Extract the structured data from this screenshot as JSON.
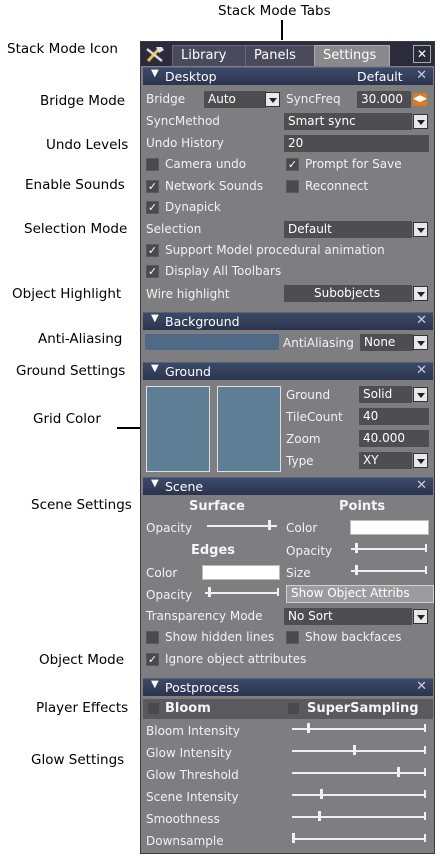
{
  "annotations": {
    "stack_mode_tabs": "Stack Mode Tabs",
    "stack_mode_icon": "Stack Mode Icon",
    "bridge_mode": "Bridge Mode",
    "undo_levels": "Undo Levels",
    "enable_sounds": "Enable Sounds",
    "selection_mode": "Selection Mode",
    "object_highlight": "Object Highlight",
    "anti_aliasing": "Anti-Aliasing",
    "ground_settings": "Ground Settings",
    "grid_color": "Grid Color",
    "scene_settings": "Scene Settings",
    "object_mode": "Object Mode",
    "player_effects": "Player Effects",
    "glow_settings": "Glow Settings"
  },
  "tabs": {
    "library": "Library",
    "panels": "Panels",
    "settings": "Settings",
    "active": "Settings",
    "close": "✕"
  },
  "desktop": {
    "title": "Desktop",
    "preset": "Default",
    "bridge_label": "Bridge",
    "bridge_value": "Auto",
    "syncfreq_label": "SyncFreq",
    "syncfreq_value": "30.000",
    "syncmethod_label": "SyncMethod",
    "syncmethod_value": "Smart sync",
    "undo_label": "Undo History",
    "undo_value": "20",
    "camera_undo": "Camera undo",
    "camera_undo_checked": false,
    "prompt_save": "Prompt for Save",
    "prompt_save_checked": true,
    "network_sounds": "Network Sounds",
    "network_sounds_checked": true,
    "reconnect": "Reconnect",
    "reconnect_checked": false,
    "dynapick": "Dynapick",
    "dynapick_checked": true,
    "selection_label": "Selection",
    "selection_value": "Default",
    "support_model": "Support Model procedural animation",
    "support_model_checked": true,
    "display_toolbars": "Display All Toolbars",
    "display_toolbars_checked": true,
    "wire_label": "Wire highlight",
    "wire_value": "Subobjects"
  },
  "background": {
    "title": "Background",
    "aa_label": "AntiAliasing",
    "aa_value": "None"
  },
  "ground": {
    "title": "Ground",
    "ground_label": "Ground",
    "ground_value": "Solid",
    "tilecount_label": "TileCount",
    "tilecount_value": "40",
    "zoom_label": "Zoom",
    "zoom_value": "40.000",
    "type_label": "Type",
    "type_value": "XY"
  },
  "scene": {
    "title": "Scene",
    "surface": "Surface",
    "points": "Points",
    "edges": "Edges",
    "opacity": "Opacity",
    "color": "Color",
    "size": "Size",
    "surface_opacity": 0.95,
    "points_opacity": 0.05,
    "points_size": 0.05,
    "edges_opacity": 0.05,
    "show_attribs": "Show Object Attribs",
    "transparency_label": "Transparency Mode",
    "transparency_value": "No Sort",
    "hidden_lines": "Show hidden lines",
    "hidden_lines_checked": false,
    "backfaces": "Show backfaces",
    "backfaces_checked": false,
    "ignore_attribs": "Ignore object attributes",
    "ignore_attribs_checked": true
  },
  "postprocess": {
    "title": "Postprocess",
    "bloom": "Bloom",
    "bloom_checked": false,
    "supersampling": "SuperSampling",
    "supersampling_checked": false,
    "bloom_intensity": "Bloom Intensity",
    "glow_intensity": "Glow Intensity",
    "glow_threshold": "Glow Threshold",
    "scene_intensity": "Scene Intensity",
    "smoothness": "Smoothness",
    "downsample": "Downsample",
    "values": {
      "bloom_intensity": 0.12,
      "glow_intensity": 0.48,
      "glow_threshold": 0.82,
      "scene_intensity": 0.22,
      "smoothness": 0.2,
      "downsample": 0.0
    }
  }
}
